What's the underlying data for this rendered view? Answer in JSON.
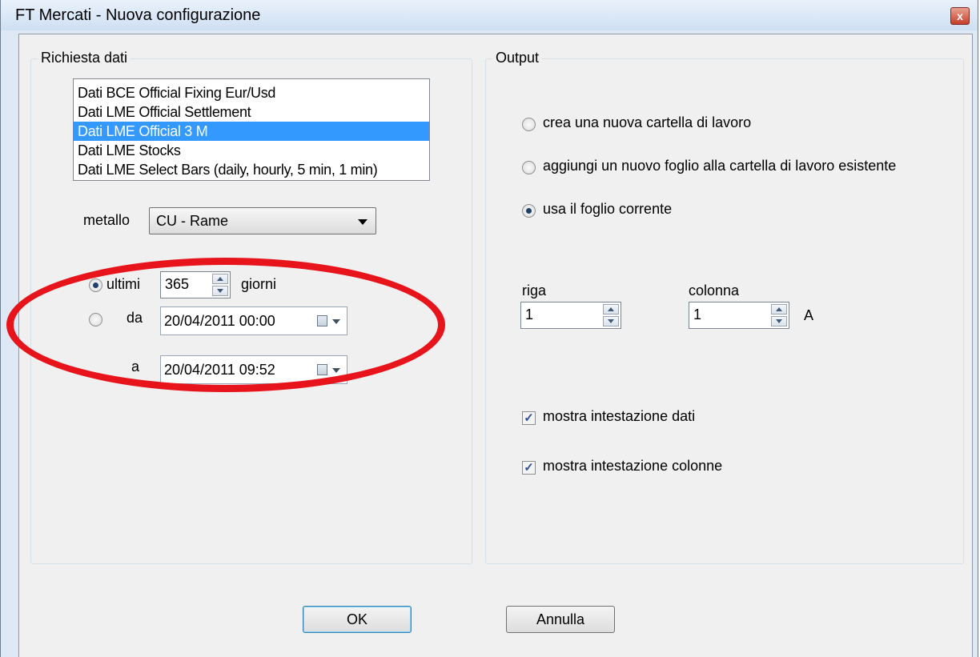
{
  "window": {
    "title": "FT Mercati - Nuova configurazione",
    "close_glyph": "x"
  },
  "request_group": {
    "legend": "Richiesta dati",
    "sources": [
      "Dati BCE Official Fixing Eur/Usd",
      "Dati LME Official Settlement",
      "Dati LME Official 3 M",
      "Dati LME Stocks",
      "Dati LME Select Bars (daily, hourly, 5 min, 1 min)"
    ],
    "selected_source": "Dati LME Official 3 M",
    "metal_label": "metallo",
    "metal_value": "CU - Rame",
    "last_label": "ultimi",
    "last_value": "365",
    "days_label": "giorni",
    "last_checked": true,
    "from_label": "da",
    "from_value": "20/04/2011 00:00",
    "to_label": "a",
    "to_value": "20/04/2011 09:52"
  },
  "output_group": {
    "legend": "Output",
    "options": [
      {
        "label": "crea una nuova cartella di lavoro",
        "checked": false
      },
      {
        "label": "aggiungi un nuovo foglio alla cartella di lavoro esistente",
        "checked": false
      },
      {
        "label": "usa il foglio corrente",
        "checked": true
      }
    ],
    "row_label": "riga",
    "row_value": "1",
    "col_label": "colonna",
    "col_value": "1",
    "col_letter": "A",
    "show_data_header": {
      "label": "mostra intestazione dati",
      "checked": true
    },
    "show_column_header": {
      "label": "mostra intestazione colonne",
      "checked": true
    }
  },
  "buttons": {
    "ok": "OK",
    "cancel": "Annulla"
  },
  "colors": {
    "annotation": "#e8141c",
    "selection": "#3399ff"
  }
}
